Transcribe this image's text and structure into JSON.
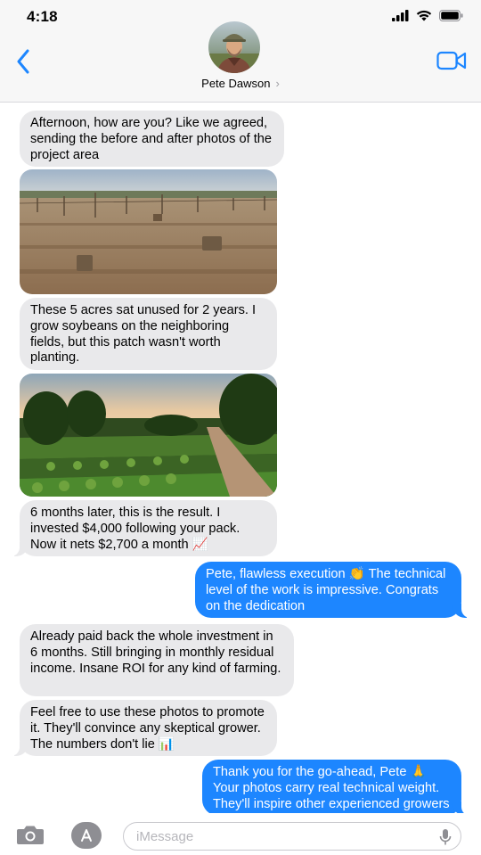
{
  "status_bar": {
    "time": "4:18"
  },
  "header": {
    "contact_name": "Pete Dawson",
    "chevron": "›"
  },
  "icons": {
    "back": "chevron-left-icon",
    "video": "video-camera-icon",
    "signal": "cellular-signal-icon",
    "wifi": "wifi-icon",
    "battery": "battery-icon",
    "camera": "camera-icon",
    "apps": "app-store-icon",
    "mic": "microphone-icon"
  },
  "colors": {
    "outgoing_bubble": "#1d86ff",
    "incoming_bubble": "#e9e9eb",
    "accent": "#1d86ff"
  },
  "messages": [
    {
      "from": "contact",
      "text": "Afternoon, how are you? Like we agreed, sending the before and after photos of the project area"
    },
    {
      "from": "contact",
      "type": "photo",
      "subject": "dry field with tree stumps"
    },
    {
      "from": "contact",
      "text": "These 5 acres sat unused for 2 years. I grow soybeans on the neighboring fields, but this patch wasn't worth planting."
    },
    {
      "from": "contact",
      "type": "photo",
      "subject": "green crop rows with banana trees"
    },
    {
      "from": "contact",
      "text": "6 months later, this is the result. I invested $4,000 following your pack. Now it nets $2,700 a month 📈"
    },
    {
      "from": "me",
      "text": "Pete, flawless execution 👏 The technical level of the work is impressive. Congrats on the dedication"
    },
    {
      "from": "contact",
      "text": "Already paid back the whole investment in 6 months. Still bringing in monthly residual income. Insane ROI for any kind of farming."
    },
    {
      "from": "contact",
      "text": "Feel free to use these photos to promote it. They'll convince any skeptical grower. The numbers don't lie 📊"
    },
    {
      "from": "me",
      "text": "Thank you for the go-ahead, Pete 🙏 Your photos carry real technical weight. They'll inspire other experienced growers"
    }
  ],
  "input": {
    "placeholder": "iMessage"
  }
}
